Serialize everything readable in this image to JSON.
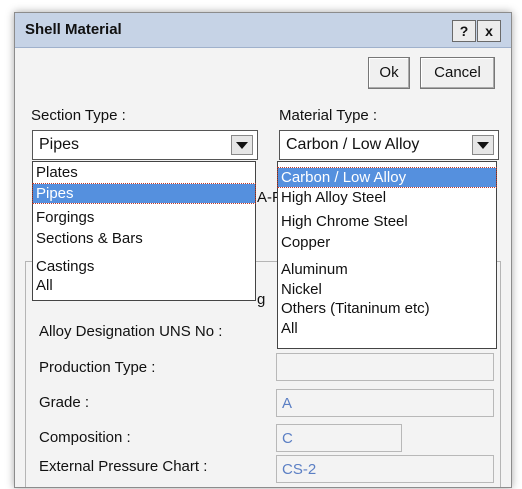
{
  "window": {
    "title": "Shell Material",
    "help_label": "?",
    "close_label": "x"
  },
  "buttons": {
    "ok": "Ok",
    "cancel": "Cancel"
  },
  "section_type": {
    "label": "Section Type :",
    "selected": "Pipes",
    "options": [
      "Plates",
      "Pipes",
      "Forgings",
      "Sections & Bars",
      "Castings",
      "All"
    ],
    "selected_index": 1
  },
  "material_type": {
    "label": "Material Type :",
    "selected": "Carbon / Low Alloy",
    "options": [
      "Carbon / Low Alloy",
      "High Alloy Steel",
      "High Chrome Steel",
      "Copper",
      "Aluminum",
      "Nickel",
      "Others (Titaninum etc)",
      "All"
    ],
    "selected_index": 0
  },
  "hidden_fragments": {
    "behind_section": "A-P",
    "behind_all": "g"
  },
  "form": {
    "alloy_designation": {
      "label": "Alloy Designation UNS No :",
      "value": ""
    },
    "production_type": {
      "label": "Production Type :",
      "value": ""
    },
    "grade": {
      "label": "Grade :",
      "value": "A"
    },
    "composition": {
      "label": "Composition :",
      "value": "C"
    },
    "external_pressure_chart": {
      "label": "External Pressure Chart :",
      "value": "CS-2"
    }
  },
  "colors": {
    "titlebar": "#c6d3e6",
    "selection": "#5590de",
    "field_text": "#5b7fc4"
  },
  "icons": {
    "dropdown_arrow": "chevron-down-icon"
  }
}
